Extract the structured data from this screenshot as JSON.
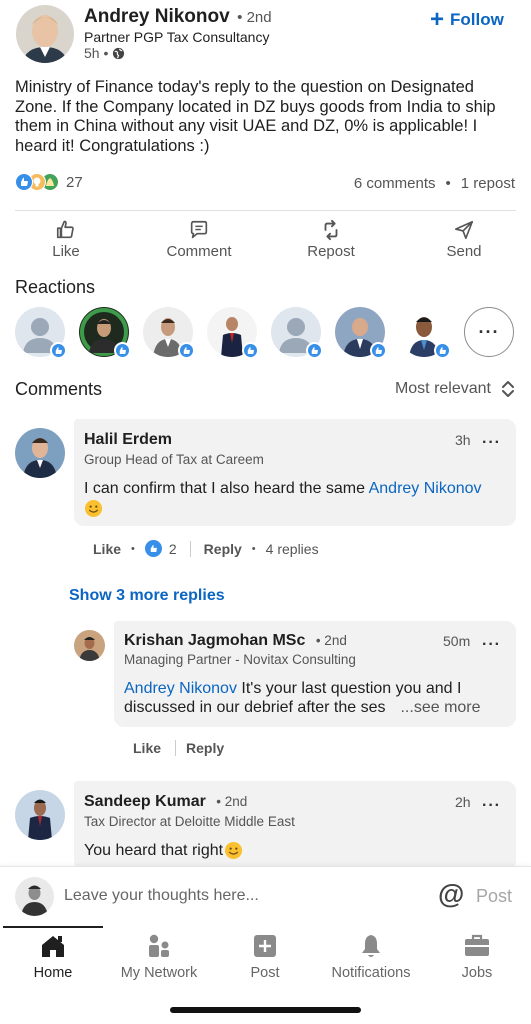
{
  "post": {
    "author_name": "Andrey Nikonov",
    "degree": "• 2nd",
    "headline": "Partner PGP Tax Consultancy",
    "time": "5h •",
    "follow_label": "Follow",
    "body_lines": [
      "Ministry of Finance today's reply to the question on Designated",
      "Zone. If the Company located in DZ buys goods from India to ship",
      "them in China without any visit UAE and DZ, 0% is applicable! I",
      "heard it! Congratulations :)"
    ],
    "reaction_count": "27",
    "comments_count": "6 comments",
    "reposts_count": "1 repost"
  },
  "actions": {
    "like": "Like",
    "comment": "Comment",
    "repost": "Repost",
    "send": "Send"
  },
  "reactions": {
    "title": "Reactions"
  },
  "comments_header": {
    "title": "Comments",
    "sort_label": "Most relevant"
  },
  "comments": {
    "c1": {
      "name": "Halil Erdem",
      "headline": "Group Head of Tax at Careem",
      "time": "3h",
      "text_prefix": "I can confirm that I also heard the same ",
      "mention": "Andrey Nikonov",
      "like": "Like",
      "like_count": "2",
      "reply": "Reply",
      "replies": "4 replies"
    },
    "show_more": "Show 3 more replies",
    "r1": {
      "name": "Krishan Jagmohan MSc",
      "degree": "• 2nd",
      "headline": "Managing Partner - Novitax Consulting",
      "time": "50m",
      "mention": "Andrey Nikonov",
      "text_line1": " It's your last question you and I",
      "text_line2": "discussed in our debrief after the ses",
      "see_more": "...see more",
      "like": "Like",
      "reply": "Reply"
    },
    "c2": {
      "name": "Sandeep Kumar",
      "degree": "• 2nd",
      "headline": "Tax Director at Deloitte Middle East",
      "time": "2h",
      "text": "You heard that right"
    }
  },
  "composer": {
    "placeholder": "Leave your thoughts here...",
    "at_symbol": "@",
    "post_label": "Post"
  },
  "nav": {
    "home": "Home",
    "network": "My Network",
    "post": "Post",
    "notifications": "Notifications",
    "jobs": "Jobs"
  },
  "colors": {
    "accent": "#0a66c2",
    "like_blue": "#378fe9",
    "bubble": "#f2f2f2"
  }
}
